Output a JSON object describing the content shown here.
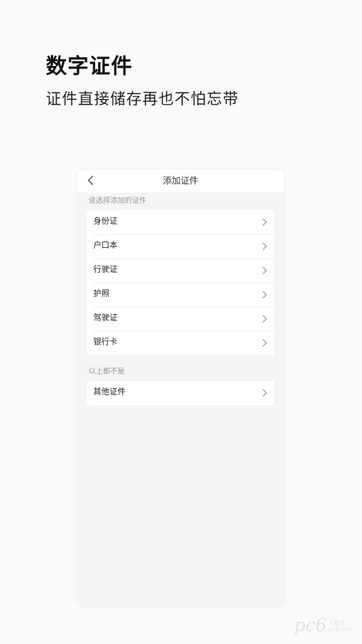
{
  "promo": {
    "title": "数字证件",
    "subtitle": "证件直接储存再也不怕忘带"
  },
  "screen": {
    "nav": {
      "back_icon": "chevron-left-icon",
      "title": "添加证件"
    },
    "sections": [
      {
        "label": "请选择添加的证件",
        "items": [
          {
            "label": "身份证"
          },
          {
            "label": "户口本"
          },
          {
            "label": "行驶证"
          },
          {
            "label": "护照"
          },
          {
            "label": "驾驶证"
          },
          {
            "label": "银行卡"
          }
        ]
      },
      {
        "label": "以上都不是",
        "items": [
          {
            "label": "其他证件"
          }
        ]
      }
    ]
  },
  "watermark": {
    "logo": "pc6",
    "line1": "下载站",
    "line2": "pc6.com"
  },
  "colors": {
    "page_background": "#fafafa",
    "card_background": "#f5f5f5",
    "list_background": "#ffffff",
    "section_label": "#999999",
    "text_primary": "#222222"
  }
}
